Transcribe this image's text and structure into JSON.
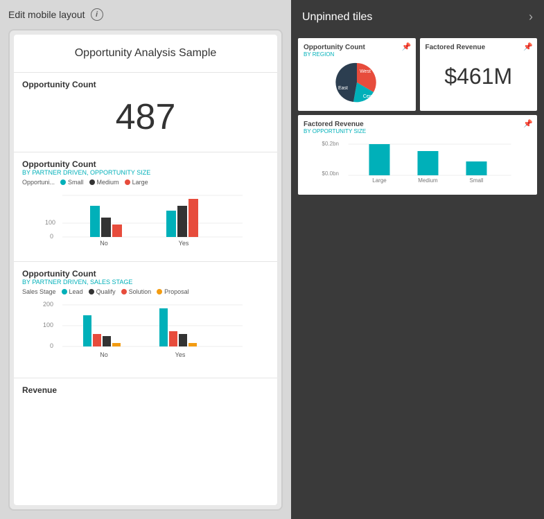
{
  "left": {
    "header_label": "Edit mobile layout",
    "info_tooltip": "i",
    "title_card": {
      "title": "Opportunity Analysis Sample"
    },
    "card1": {
      "title": "Opportunity Count",
      "number": "487"
    },
    "card2": {
      "title": "Opportunity Count",
      "subtitle": "BY PARTNER DRIVEN, OPPORTUNITY SIZE",
      "legend": [
        {
          "label": "Opportuni...",
          "color": "#555"
        },
        {
          "label": "Small",
          "color": "#00b0b9"
        },
        {
          "label": "Medium",
          "color": "#333"
        },
        {
          "label": "Large",
          "color": "#e74c3c"
        }
      ],
      "y_labels": [
        "100",
        "0"
      ],
      "x_labels": [
        "No",
        "Yes"
      ],
      "bars_no": [
        {
          "height": 55,
          "color": "#00b0b9"
        },
        {
          "height": 30,
          "color": "#333"
        },
        {
          "height": 18,
          "color": "#e74c3c"
        }
      ],
      "bars_yes": [
        {
          "height": 40,
          "color": "#00b0b9"
        },
        {
          "height": 55,
          "color": "#333"
        },
        {
          "height": 65,
          "color": "#e74c3c"
        }
      ]
    },
    "card3": {
      "title": "Opportunity Count",
      "subtitle": "BY PARTNER DRIVEN, SALES STAGE",
      "legend": [
        {
          "label": "Sales Stage",
          "color": "#555"
        },
        {
          "label": "Lead",
          "color": "#00b0b9"
        },
        {
          "label": "Qualify",
          "color": "#333"
        },
        {
          "label": "Solution",
          "color": "#e74c3c"
        },
        {
          "label": "Proposal",
          "color": "#f39c12"
        }
      ],
      "y_labels": [
        "200",
        "100",
        "0"
      ],
      "x_labels": [
        "No",
        "Yes"
      ],
      "bars_no": [
        {
          "height": 55,
          "color": "#00b0b9"
        },
        {
          "height": 20,
          "color": "#e74c3c"
        },
        {
          "height": 15,
          "color": "#333"
        },
        {
          "height": 5,
          "color": "#f39c12"
        }
      ],
      "bars_yes": [
        {
          "height": 70,
          "color": "#00b0b9"
        },
        {
          "height": 25,
          "color": "#e74c3c"
        },
        {
          "height": 20,
          "color": "#333"
        },
        {
          "height": 5,
          "color": "#f39c12"
        }
      ]
    },
    "card4": {
      "title": "Revenue"
    }
  },
  "right": {
    "header": "Unpinned tiles",
    "chevron": "›",
    "tile1": {
      "title": "Opportunity Count",
      "subtitle": "BY REGION",
      "pin_icon": "📌"
    },
    "tile2": {
      "title": "Factored Revenue",
      "value": "$461M",
      "pin_icon": "📌"
    },
    "tile3": {
      "title": "Factored Revenue",
      "subtitle": "BY OPPORTUNITY SIZE",
      "pin_icon": "📌",
      "y_labels": [
        "$0.2bn",
        "$0.0bn"
      ],
      "bars": [
        {
          "label": "Large",
          "height": 45
        },
        {
          "label": "Medium",
          "height": 35
        },
        {
          "label": "Small",
          "height": 18
        }
      ]
    },
    "pie": {
      "labels": [
        "West",
        "East",
        "Central"
      ],
      "colors": [
        "#e74c3c",
        "#2c3e50",
        "#00b0b9"
      ]
    }
  }
}
